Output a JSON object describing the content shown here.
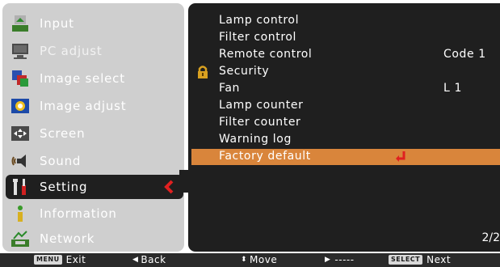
{
  "menu": {
    "items": [
      {
        "label": "Input",
        "icon": "input-icon"
      },
      {
        "label": "PC adjust",
        "icon": "pc-adjust-icon"
      },
      {
        "label": "Image select",
        "icon": "image-select-icon"
      },
      {
        "label": "Image adjust",
        "icon": "image-adjust-icon"
      },
      {
        "label": "Screen",
        "icon": "screen-icon"
      },
      {
        "label": "Sound",
        "icon": "sound-icon"
      },
      {
        "label": "Setting",
        "icon": "setting-icon"
      },
      {
        "label": "Information",
        "icon": "information-icon"
      },
      {
        "label": "Network",
        "icon": "network-icon"
      }
    ],
    "selected_index": 6
  },
  "options": {
    "items": [
      {
        "label": "Lamp control",
        "value": ""
      },
      {
        "label": "Filter control",
        "value": ""
      },
      {
        "label": "Remote control",
        "value": "Code 1"
      },
      {
        "label": "Security",
        "value": ""
      },
      {
        "label": "Fan",
        "value": "L 1"
      },
      {
        "label": "Lamp counter",
        "value": ""
      },
      {
        "label": "Filter counter",
        "value": ""
      },
      {
        "label": "Warning log",
        "value": ""
      },
      {
        "label": "Factory default",
        "value": ""
      }
    ],
    "highlighted_index": 8,
    "page": "2/2"
  },
  "footer": {
    "exit_key": "MENU",
    "exit_label": "Exit",
    "back_label": "Back",
    "move_label": "Move",
    "next_value": "-----",
    "select_key": "SELECT",
    "next_label": "Next"
  },
  "colors": {
    "menu_bg": "#cfcfcf",
    "panel_bg": "#1f1f1f",
    "highlight": "#d9853b",
    "accent_red": "#e02020"
  }
}
